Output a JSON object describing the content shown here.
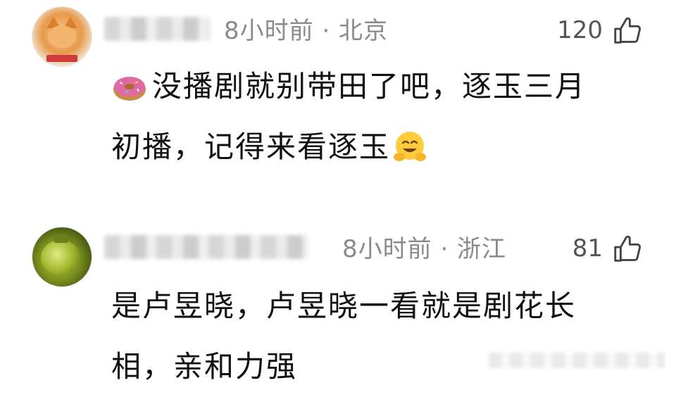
{
  "comments": [
    {
      "time_location": "8小时前 · 北京",
      "likes": "120",
      "text_line1_a": "没播剧就别带田了吧，逐玉三月",
      "text_line2_a": "初播，记得来看逐玉",
      "emoji_inline": "donut-icon",
      "emoji_end": "hugging-face-icon"
    },
    {
      "time_location": "8小时前 · 浙江",
      "likes": "81",
      "text_line1": "是卢昱晓，卢昱晓一看就是剧花长",
      "text_line2": "相，亲和力强"
    }
  ],
  "icons": {
    "like": "thumbs-up-outline-icon"
  },
  "colors": {
    "meta_text": "#8a8a8a",
    "body_text": "#111111",
    "background": "#ffffff"
  }
}
